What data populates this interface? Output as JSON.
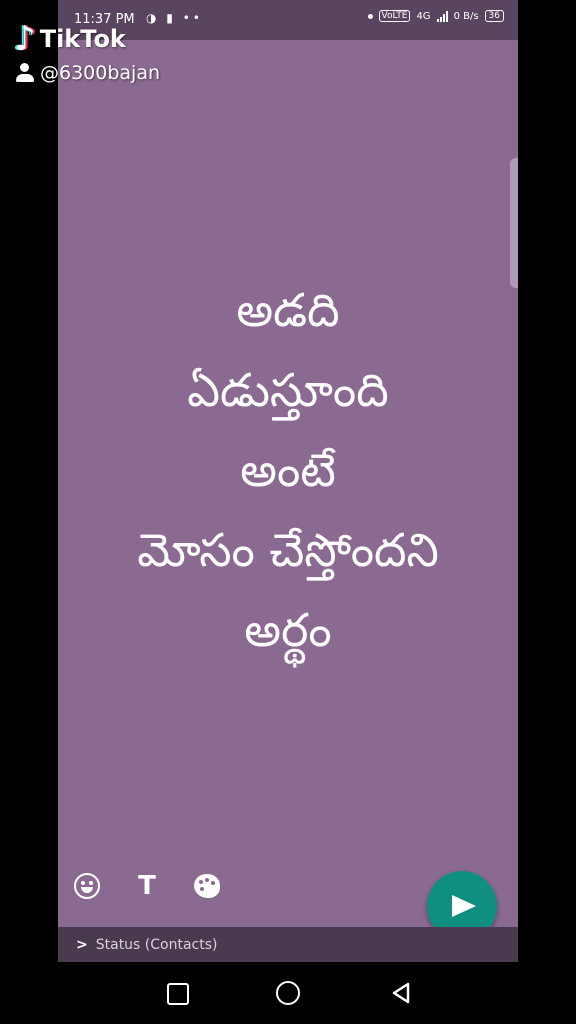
{
  "statusbar": {
    "time": "11:37 PM",
    "network": "4G",
    "volte": "VoLTE",
    "speed": "0 B/s",
    "battery": "36"
  },
  "watermark": {
    "brand": "TikTok",
    "handle": "@6300bajan"
  },
  "status_editor": {
    "background_color": "#8b6a91",
    "lines": [
      "అడది",
      "ఏడుస్తూంది",
      "అంటే",
      "మోసం చేస్తోందని",
      "అర్థం"
    ],
    "tools": {
      "emoji_icon": "emoji-icon",
      "text_label": "T",
      "palette_icon": "palette-icon"
    },
    "send_icon": "send-icon",
    "audience_label": "Status (Contacts)"
  },
  "navbar": {
    "icons": [
      "recents-icon",
      "home-icon",
      "back-icon"
    ]
  }
}
